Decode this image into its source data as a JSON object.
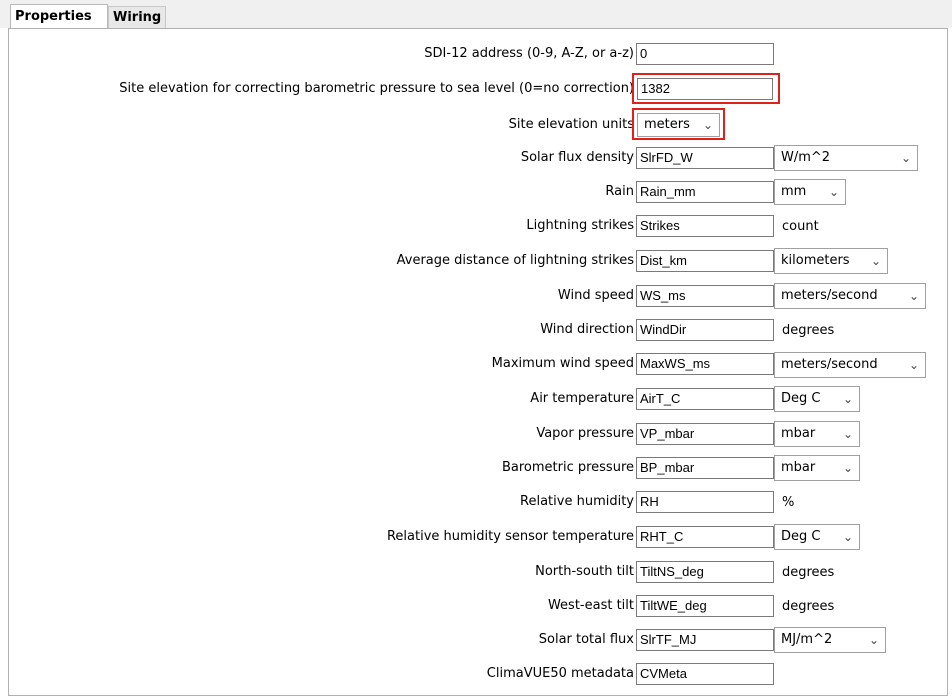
{
  "tabs": [
    {
      "label": "Properties",
      "active": true
    },
    {
      "label": "Wiring",
      "active": false
    }
  ],
  "fields": {
    "sdi12_address": {
      "label": "SDI-12 address (0-9, A-Z, or a-z)",
      "value": "0"
    },
    "site_elevation": {
      "label": "Site elevation for correcting barometric pressure to sea level (0=no correction)",
      "value": "1382"
    },
    "site_elevation_units": {
      "label": "Site elevation units",
      "value": "meters"
    },
    "solar_flux_density": {
      "label": "Solar flux density",
      "value": "SlrFD_W",
      "unit": "W/m^2"
    },
    "rain": {
      "label": "Rain",
      "value": "Rain_mm",
      "unit": "mm"
    },
    "lightning_strikes": {
      "label": "Lightning strikes",
      "value": "Strikes",
      "unit": "count"
    },
    "avg_distance_lightning": {
      "label": "Average distance of lightning strikes",
      "value": "Dist_km",
      "unit": "kilometers"
    },
    "wind_speed": {
      "label": "Wind speed",
      "value": "WS_ms",
      "unit": "meters/second"
    },
    "wind_direction": {
      "label": "Wind direction",
      "value": "WindDir",
      "unit": "degrees"
    },
    "max_wind_speed": {
      "label": "Maximum wind speed",
      "value": "MaxWS_ms",
      "unit": "meters/second"
    },
    "air_temperature": {
      "label": "Air temperature",
      "value": "AirT_C",
      "unit": "Deg C"
    },
    "vapor_pressure": {
      "label": "Vapor pressure",
      "value": "VP_mbar",
      "unit": "mbar"
    },
    "barometric_pressure": {
      "label": "Barometric pressure",
      "value": "BP_mbar",
      "unit": "mbar"
    },
    "relative_humidity": {
      "label": "Relative humidity",
      "value": "RH",
      "unit": "%"
    },
    "rh_sensor_temperature": {
      "label": "Relative humidity sensor temperature",
      "value": "RHT_C",
      "unit": "Deg C"
    },
    "north_south_tilt": {
      "label": "North-south tilt",
      "value": "TiltNS_deg",
      "unit": "degrees"
    },
    "west_east_tilt": {
      "label": "West-east tilt",
      "value": "TiltWE_deg",
      "unit": "degrees"
    },
    "solar_total_flux": {
      "label": "Solar total flux",
      "value": "SlrTF_MJ",
      "unit": "MJ/m^2"
    },
    "climavue_metadata": {
      "label": "ClimaVUE50 metadata",
      "value": "CVMeta"
    }
  },
  "highlight_color": "#e0201a",
  "icons": {
    "dropdown": "chevron-down-icon"
  }
}
